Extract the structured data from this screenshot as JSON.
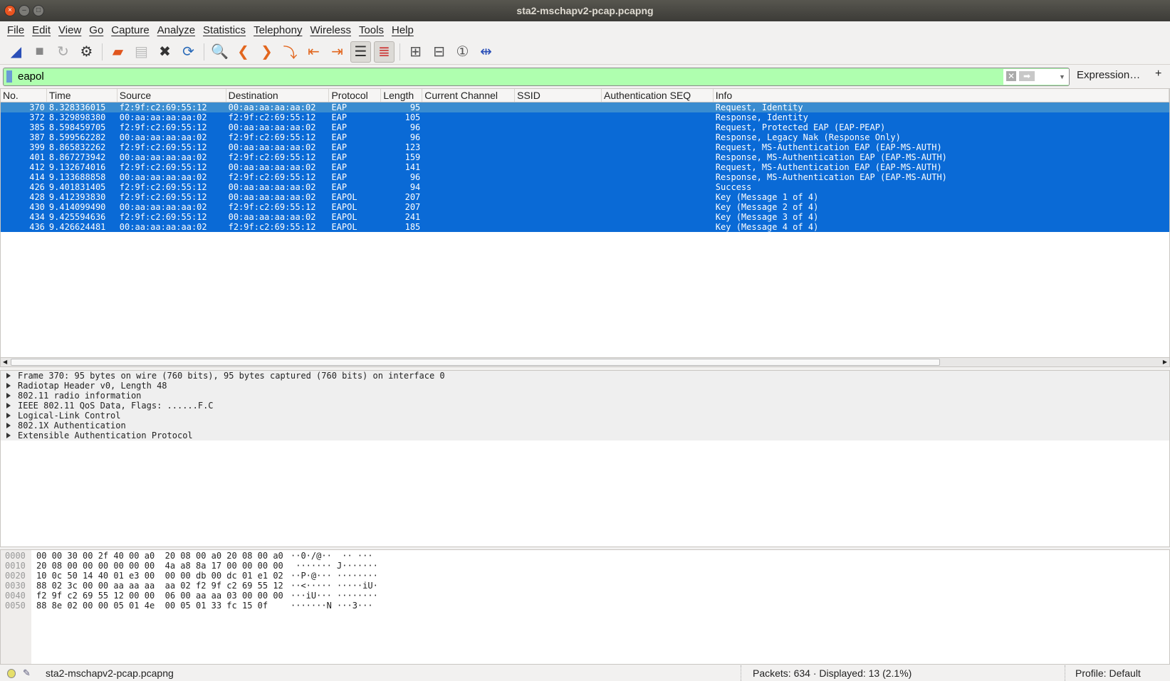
{
  "window": {
    "title": "sta2-mschapv2-pcap.pcapng"
  },
  "menu": [
    "File",
    "Edit",
    "View",
    "Go",
    "Capture",
    "Analyze",
    "Statistics",
    "Telephony",
    "Wireless",
    "Tools",
    "Help"
  ],
  "toolbar": [
    "shark-fin-start-icon",
    "stop-icon",
    "restart-icon",
    "options-gear-icon",
    "|",
    "open-folder-icon",
    "file-icon",
    "close-file-icon",
    "reload-file-icon",
    "|",
    "search-icon",
    "back-icon",
    "forward-icon",
    "goto-packet-icon",
    "first-packet-icon",
    "last-packet-icon",
    "autoscroll-icon",
    "colorize-icon",
    "|",
    "zoom-in-icon",
    "zoom-out-icon",
    "normal-size-icon",
    "resize-columns-icon"
  ],
  "filter": {
    "value": "eapol",
    "expression_label": "Expression…",
    "add_label": "+",
    "bg_color": "#afffaf"
  },
  "columns": [
    "No.",
    "Time",
    "Source",
    "Destination",
    "Protocol",
    "Length",
    "Current Channel",
    "SSID",
    "Authentication SEQ",
    "Info"
  ],
  "packets": [
    [
      "370",
      "8.328336015",
      "f2:9f:c2:69:55:12",
      "00:aa:aa:aa:aa:02",
      "EAP",
      "95",
      "",
      "",
      "",
      "Request, Identity"
    ],
    [
      "372",
      "8.329898380",
      "00:aa:aa:aa:aa:02",
      "f2:9f:c2:69:55:12",
      "EAP",
      "105",
      "",
      "",
      "",
      "Response, Identity"
    ],
    [
      "385",
      "8.598459705",
      "f2:9f:c2:69:55:12",
      "00:aa:aa:aa:aa:02",
      "EAP",
      "96",
      "",
      "",
      "",
      "Request, Protected EAP (EAP-PEAP)"
    ],
    [
      "387",
      "8.599562282",
      "00:aa:aa:aa:aa:02",
      "f2:9f:c2:69:55:12",
      "EAP",
      "96",
      "",
      "",
      "",
      "Response, Legacy Nak (Response Only)"
    ],
    [
      "399",
      "8.865832262",
      "f2:9f:c2:69:55:12",
      "00:aa:aa:aa:aa:02",
      "EAP",
      "123",
      "",
      "",
      "",
      "Request, MS-Authentication EAP (EAP-MS-AUTH)"
    ],
    [
      "401",
      "8.867273942",
      "00:aa:aa:aa:aa:02",
      "f2:9f:c2:69:55:12",
      "EAP",
      "159",
      "",
      "",
      "",
      "Response, MS-Authentication EAP (EAP-MS-AUTH)"
    ],
    [
      "412",
      "9.132674016",
      "f2:9f:c2:69:55:12",
      "00:aa:aa:aa:aa:02",
      "EAP",
      "141",
      "",
      "",
      "",
      "Request, MS-Authentication EAP (EAP-MS-AUTH)"
    ],
    [
      "414",
      "9.133688858",
      "00:aa:aa:aa:aa:02",
      "f2:9f:c2:69:55:12",
      "EAP",
      "96",
      "",
      "",
      "",
      "Response, MS-Authentication EAP (EAP-MS-AUTH)"
    ],
    [
      "426",
      "9.401831405",
      "f2:9f:c2:69:55:12",
      "00:aa:aa:aa:aa:02",
      "EAP",
      "94",
      "",
      "",
      "",
      "Success"
    ],
    [
      "428",
      "9.412393830",
      "f2:9f:c2:69:55:12",
      "00:aa:aa:aa:aa:02",
      "EAPOL",
      "207",
      "",
      "",
      "",
      "Key (Message 1 of 4)"
    ],
    [
      "430",
      "9.414099490",
      "00:aa:aa:aa:aa:02",
      "f2:9f:c2:69:55:12",
      "EAPOL",
      "207",
      "",
      "",
      "",
      "Key (Message 2 of 4)"
    ],
    [
      "434",
      "9.425594636",
      "f2:9f:c2:69:55:12",
      "00:aa:aa:aa:aa:02",
      "EAPOL",
      "241",
      "",
      "",
      "",
      "Key (Message 3 of 4)"
    ],
    [
      "436",
      "9.426624481",
      "00:aa:aa:aa:aa:02",
      "f2:9f:c2:69:55:12",
      "EAPOL",
      "185",
      "",
      "",
      "",
      "Key (Message 4 of 4)"
    ]
  ],
  "selected_packet": "370",
  "details": [
    "Frame 370: 95 bytes on wire (760 bits), 95 bytes captured (760 bits) on interface 0",
    "Radiotap Header v0, Length 48",
    "802.11 radio information",
    "IEEE 802.11 QoS Data, Flags: ......F.C",
    "Logical-Link Control",
    "802.1X Authentication",
    "Extensible Authentication Protocol"
  ],
  "hex": [
    [
      "0000",
      "00 00 30 00 2f 40 00 a0  20 08 00 a0 20 08 00 a0",
      "··0·/@··  ·· ···"
    ],
    [
      "0010",
      "20 08 00 00 00 00 00 00  4a a8 8a 17 00 00 00 00",
      " ······· J·······"
    ],
    [
      "0020",
      "10 0c 50 14 40 01 e3 00  00 00 db 00 dc 01 e1 02",
      "··P·@··· ········"
    ],
    [
      "0030",
      "88 02 3c 00 00 aa aa aa  aa 02 f2 9f c2 69 55 12",
      "··<····· ·····iU·"
    ],
    [
      "0040",
      "f2 9f c2 69 55 12 00 00  06 00 aa aa 03 00 00 00",
      "···iU··· ········"
    ],
    [
      "0050",
      "88 8e 02 00 00 05 01 4e  00 05 01 33 fc 15 0f",
      "·······N ···3···"
    ]
  ],
  "status": {
    "file": "sta2-mschapv2-pcap.pcapng",
    "packets": "Packets: 634 · Displayed: 13 (2.1%)",
    "profile": "Profile: Default"
  }
}
